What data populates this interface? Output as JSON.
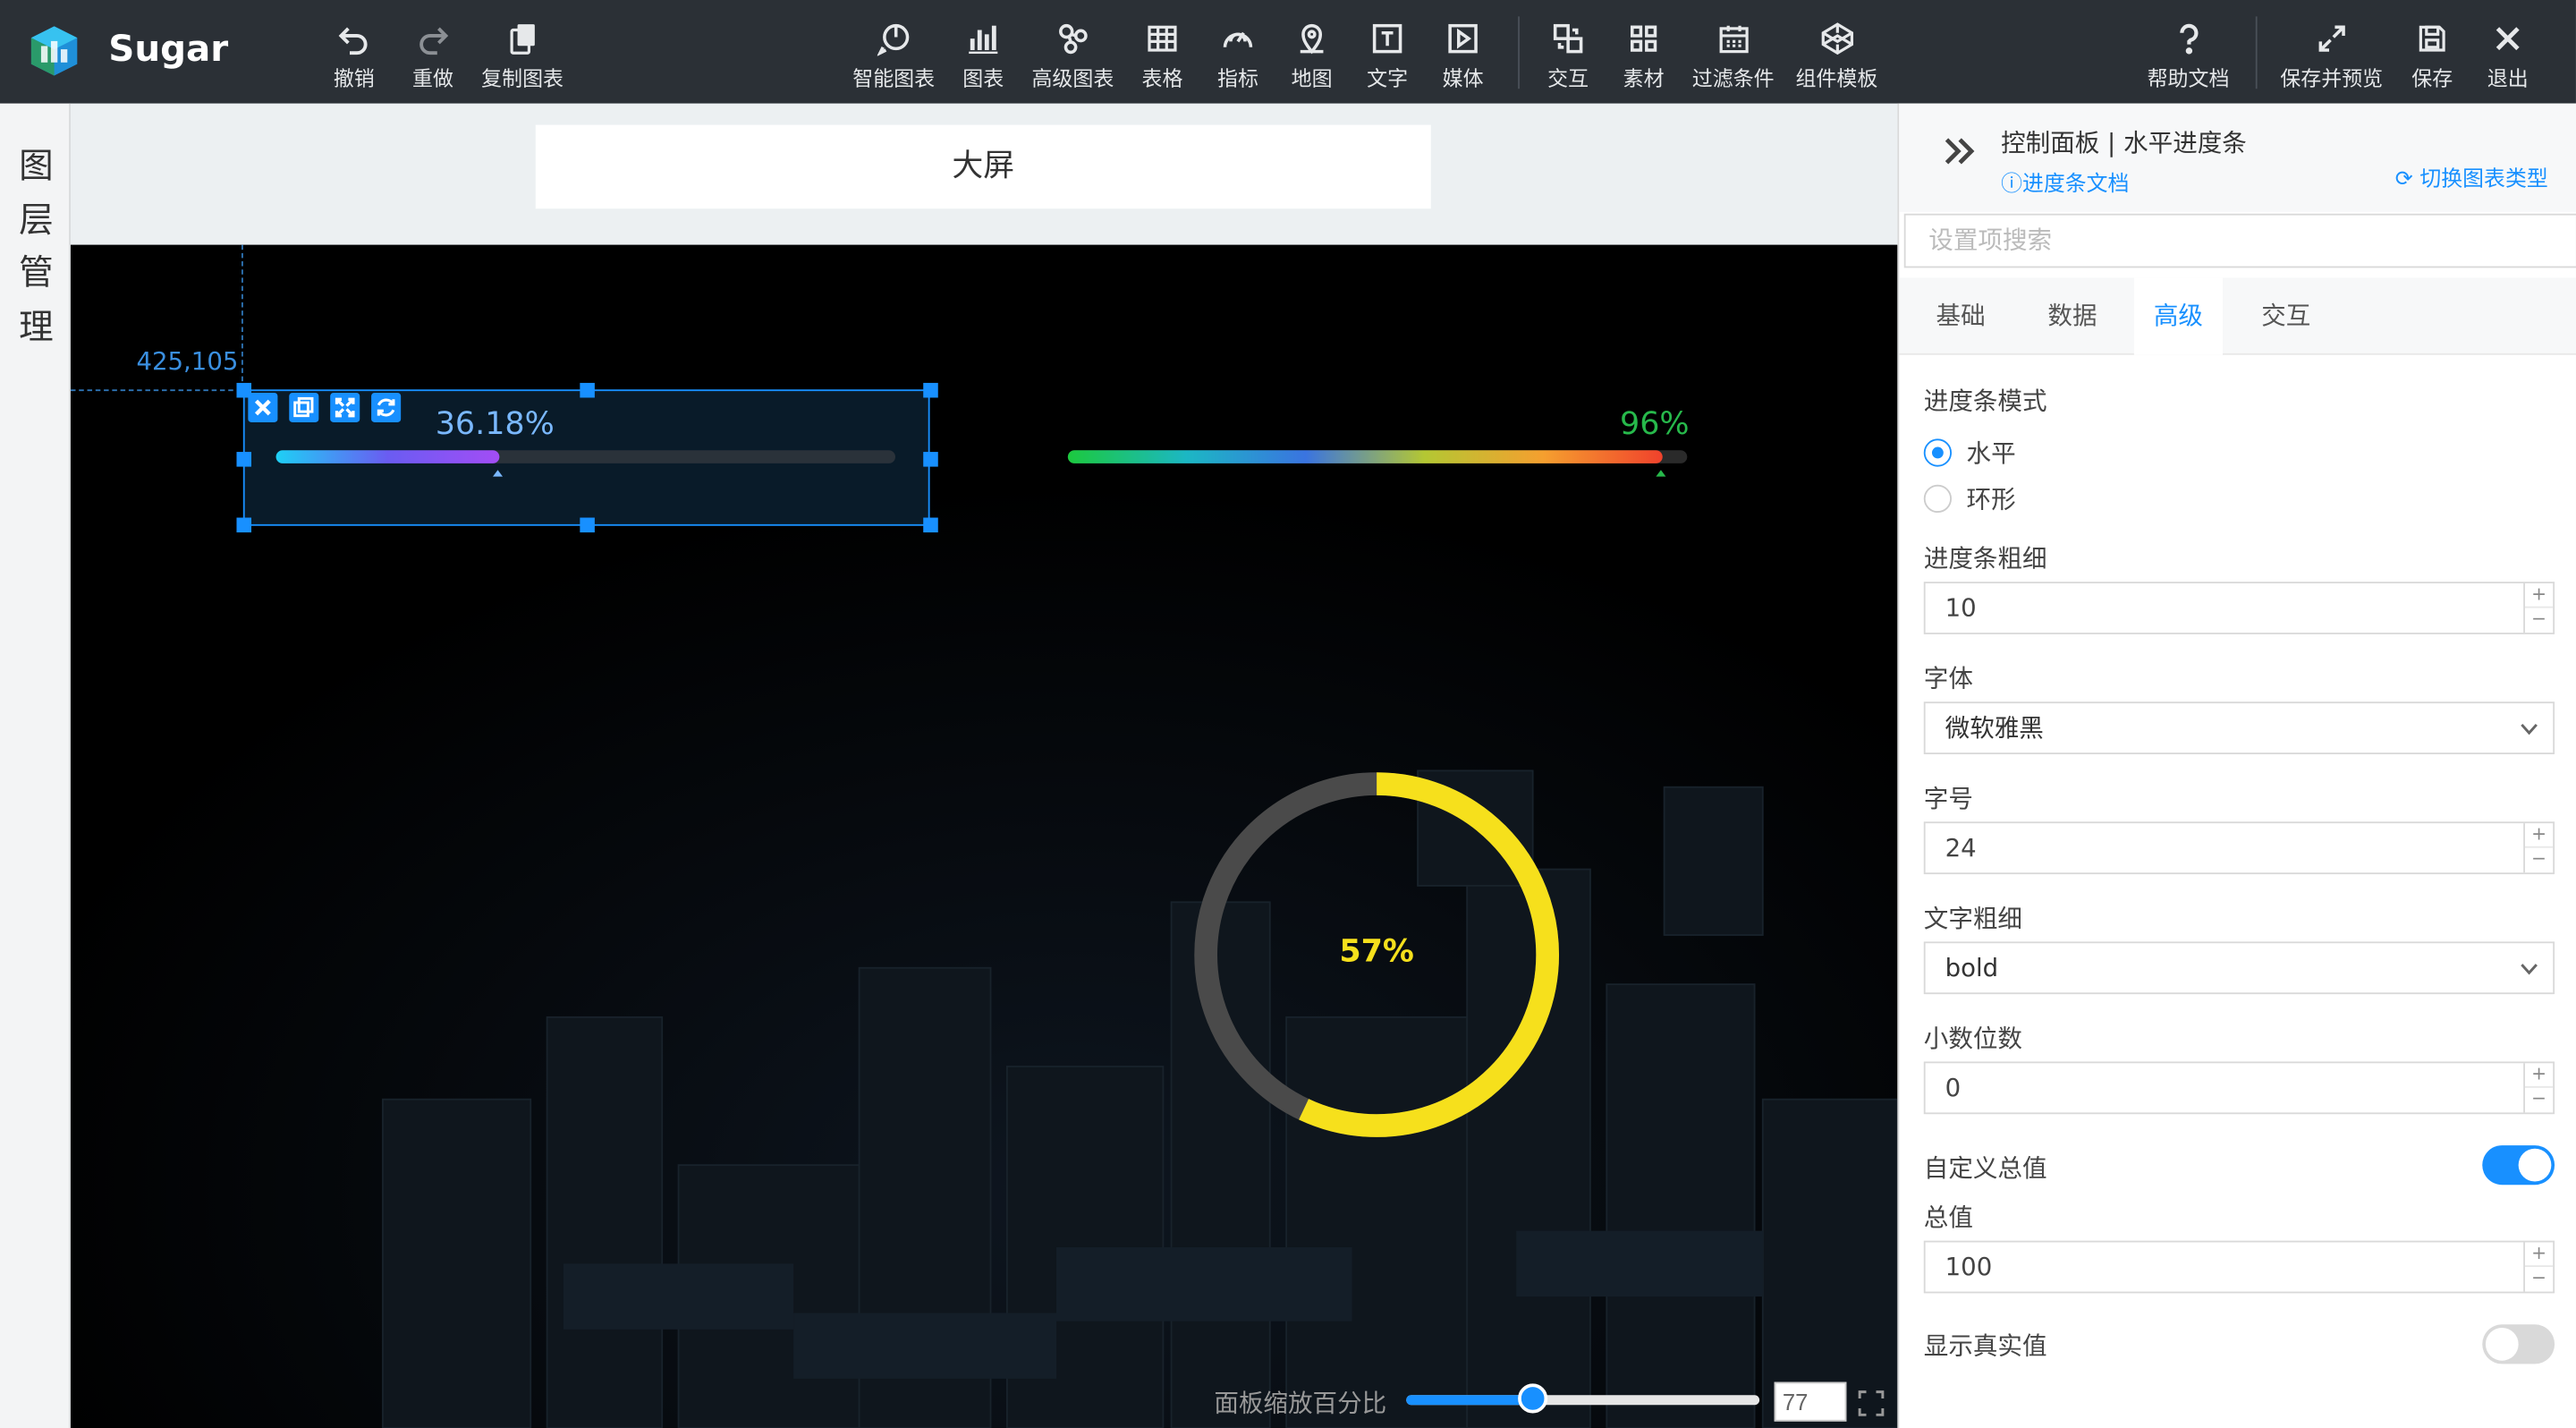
{
  "app": {
    "brand": "Sugar"
  },
  "toolbar": {
    "left": [
      {
        "id": "undo",
        "label": "撤销",
        "icon": "undo-icon"
      },
      {
        "id": "redo",
        "label": "重做",
        "icon": "redo-icon"
      },
      {
        "id": "copy",
        "label": "复制图表",
        "icon": "copy-icon"
      }
    ],
    "center": [
      {
        "id": "smart",
        "label": "智能图表",
        "icon": "smart-chart-icon"
      },
      {
        "id": "chart",
        "label": "图表",
        "icon": "bar-chart-icon"
      },
      {
        "id": "adv",
        "label": "高级图表",
        "icon": "advanced-chart-icon"
      },
      {
        "id": "table",
        "label": "表格",
        "icon": "table-icon"
      },
      {
        "id": "metric",
        "label": "指标",
        "icon": "gauge-icon"
      },
      {
        "id": "map",
        "label": "地图",
        "icon": "map-pin-icon"
      },
      {
        "id": "text",
        "label": "文字",
        "icon": "text-icon"
      },
      {
        "id": "media",
        "label": "媒体",
        "icon": "media-icon"
      },
      {
        "id": "interact",
        "label": "交互",
        "icon": "interaction-icon"
      },
      {
        "id": "material",
        "label": "素材",
        "icon": "grid-icon"
      },
      {
        "id": "filter",
        "label": "过滤条件",
        "icon": "calendar-filter-icon"
      },
      {
        "id": "template",
        "label": "组件模板",
        "icon": "codepen-icon"
      }
    ],
    "right": [
      {
        "id": "help",
        "label": "帮助文档",
        "icon": "help-icon"
      },
      {
        "id": "preview",
        "label": "保存并预览",
        "icon": "expand-icon"
      },
      {
        "id": "save",
        "label": "保存",
        "icon": "save-icon"
      },
      {
        "id": "exit",
        "label": "退出",
        "icon": "close-icon"
      }
    ]
  },
  "left_strip": {
    "title": "图层管理"
  },
  "canvas": {
    "screen_title": "大屏",
    "coord_label": "425,105",
    "zoom_label": "面板缩放百分比",
    "zoom_value": "77",
    "zoom_fraction": 0.36
  },
  "widgets": {
    "bar1": {
      "label": "36.18%",
      "value": 0.3618
    },
    "bar2": {
      "label": "96%",
      "value": 0.96
    },
    "ring": {
      "label": "57%",
      "value": 0.57,
      "color": "#f6e01c",
      "track": "#4a4a4a"
    }
  },
  "panel": {
    "title": "控制面板 | 水平进度条",
    "doc_link": "进度条文档",
    "switch_link": "切换图表类型",
    "search_placeholder": "设置项搜索",
    "tabs": [
      "基础",
      "数据",
      "高级",
      "交互"
    ],
    "active_tab": 2,
    "mode_label": "进度条模式",
    "mode_options": [
      "水平",
      "环形"
    ],
    "thickness_label": "进度条粗细",
    "thickness_value": "10",
    "font_label": "字体",
    "font_value": "微软雅黑",
    "font_size_label": "字号",
    "font_size_value": "24",
    "font_weight_label": "文字粗细",
    "font_weight_value": "bold",
    "decimals_label": "小数位数",
    "decimals_value": "0",
    "custom_total_label": "自定义总值",
    "custom_total_on": true,
    "total_label": "总值",
    "total_value": "100",
    "show_real_label": "显示真实值",
    "show_real_on": false
  },
  "colors": {
    "accent": "#1890ff",
    "topbar": "#2b3036"
  }
}
